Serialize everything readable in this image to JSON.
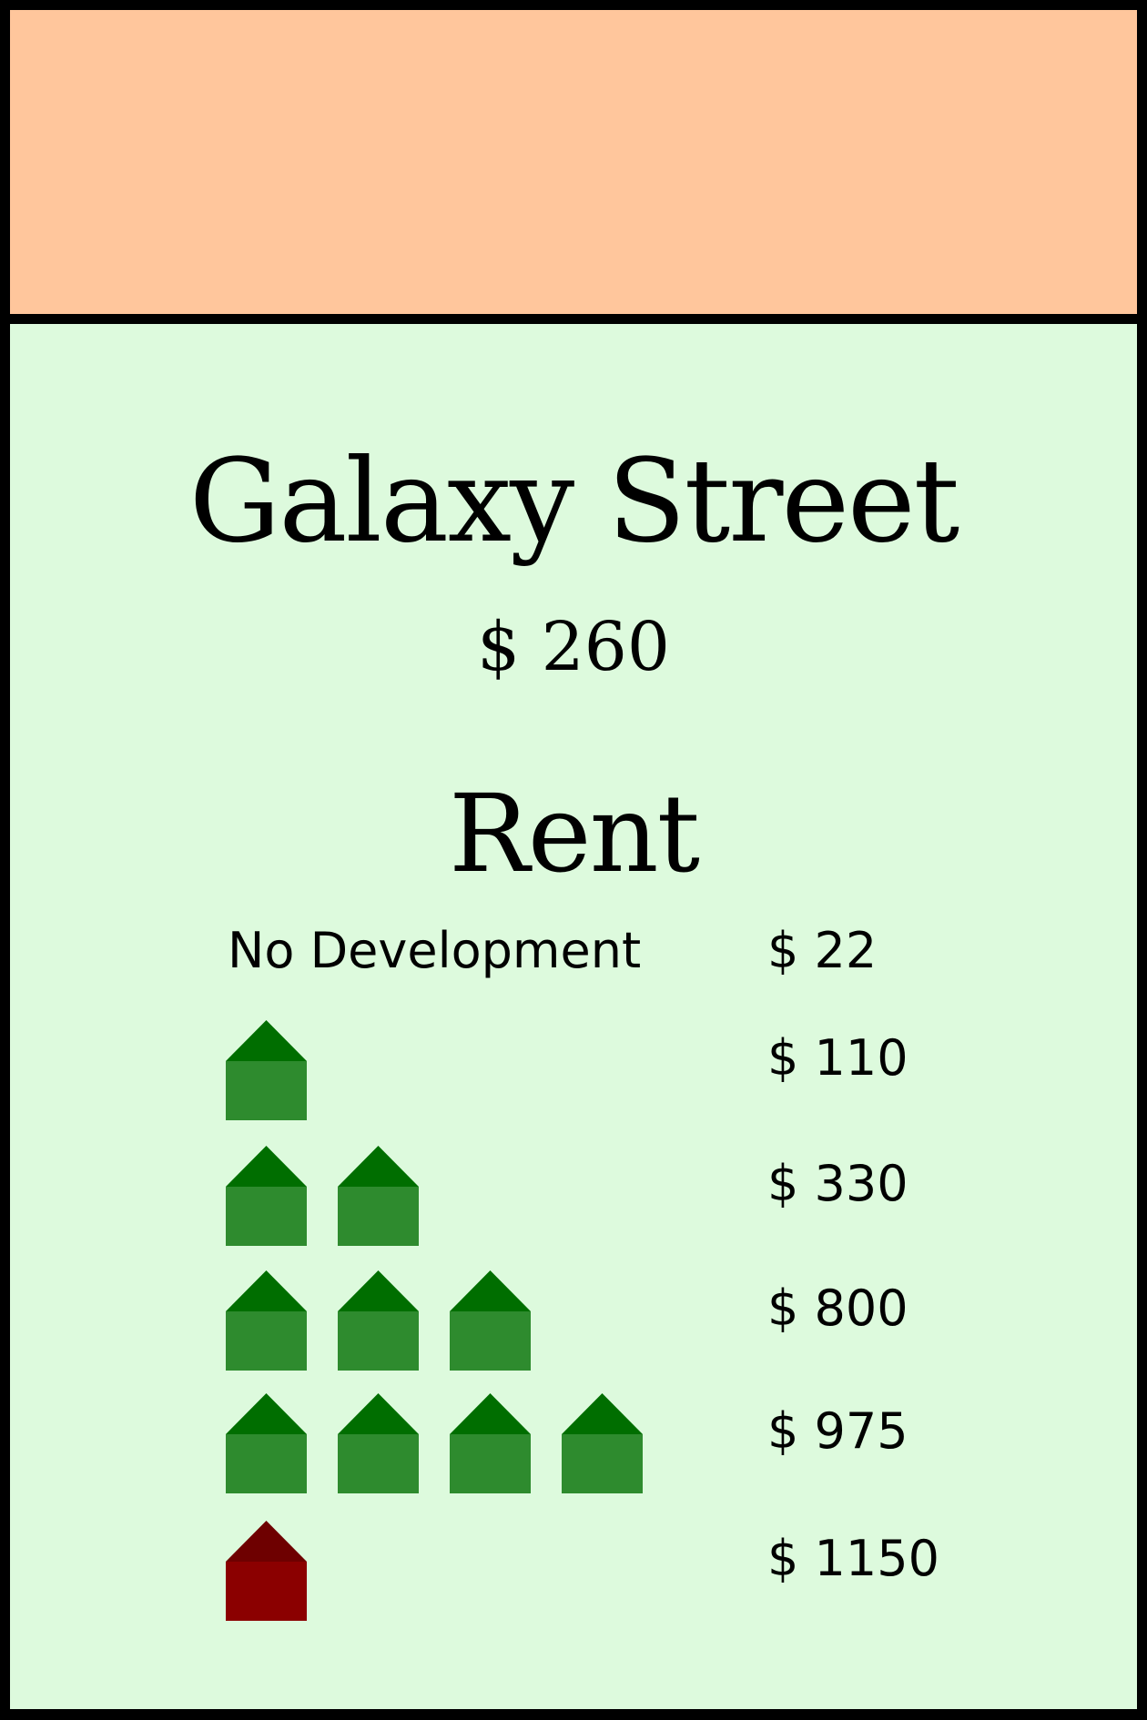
{
  "card": {
    "title": "Galaxy Street",
    "price": "$ 260",
    "band_color": "#FFC69C",
    "body_color": "#DDFADD",
    "border_color": "#000000"
  },
  "rent": {
    "heading": "Rent",
    "rows": [
      {
        "label": "No Development",
        "value": "$ 22",
        "houses": 0,
        "hotel": false
      },
      {
        "label": "",
        "value": "$ 110",
        "houses": 1,
        "hotel": false
      },
      {
        "label": "",
        "value": "$ 330",
        "houses": 2,
        "hotel": false
      },
      {
        "label": "",
        "value": "$ 800",
        "houses": 3,
        "hotel": false
      },
      {
        "label": "",
        "value": "$ 975",
        "houses": 4,
        "hotel": false
      },
      {
        "label": "",
        "value": "$ 1150",
        "houses": 0,
        "hotel": true
      }
    ]
  },
  "icons": {
    "house": "house-icon",
    "hotel": "hotel-icon",
    "house_roof_color": "#006E00",
    "house_body_color": "#2E8B2E",
    "hotel_roof_color": "#6E0000",
    "hotel_body_color": "#8B0000"
  }
}
